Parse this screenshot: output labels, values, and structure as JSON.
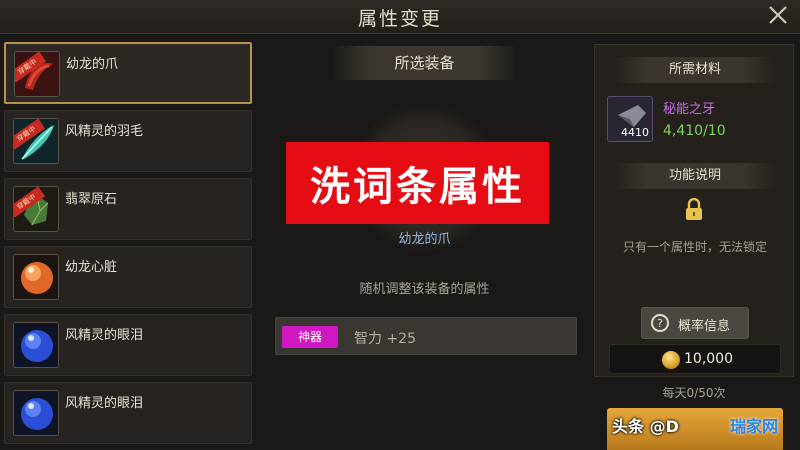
{
  "window": {
    "title": "属性变更"
  },
  "equipment_list": [
    {
      "name": "幼龙的爪",
      "tag": "穿戴中",
      "selected": true,
      "icon": "claw-icon"
    },
    {
      "name": "风精灵的羽毛",
      "tag": "穿戴中",
      "selected": false,
      "icon": "feather-icon"
    },
    {
      "name": "翡翠原石",
      "tag": "穿戴中",
      "selected": false,
      "icon": "emerald-icon"
    },
    {
      "name": "幼龙心脏",
      "tag": "",
      "selected": false,
      "icon": "heart-orb-icon"
    },
    {
      "name": "风精灵的眼泪",
      "tag": "",
      "selected": false,
      "icon": "blue-orb-icon"
    },
    {
      "name": "风精灵的眼泪",
      "tag": "",
      "selected": false,
      "icon": "blue-orb-icon"
    }
  ],
  "center": {
    "header": "所选装备",
    "banner": "洗词条属性",
    "equipment_name": "幼龙的爪",
    "description": "随机调整该装备的属性",
    "attribute": {
      "badge": "神器",
      "text": "智力 +25"
    }
  },
  "right": {
    "materials_header": "所需材料",
    "material": {
      "name": "秘能之牙",
      "count": "4410",
      "quantity": "4,410/10",
      "icon": "fang-crystal-icon"
    },
    "function_header": "功能说明",
    "note": "只有一个属性时，无法锁定",
    "probability_button": "概率信息",
    "gold": "10,000",
    "daily": "每天0/50次"
  },
  "watermark": {
    "left": "头条 @D",
    "right": "瑞家网"
  },
  "colors": {
    "accent": "#b8914a",
    "banner": "#e60c13",
    "artifact": "#cf18c4",
    "material_name": "#c36be8",
    "material_qty": "#7ed35b"
  }
}
